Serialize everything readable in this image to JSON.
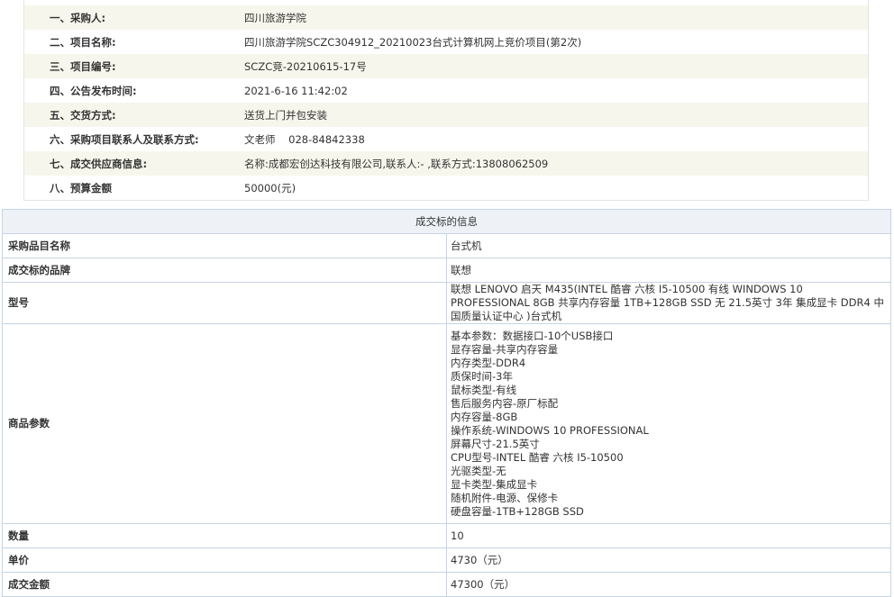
{
  "info": {
    "rows": [
      {
        "label": "一、采购人:",
        "value": "四川旅游学院"
      },
      {
        "label": "二、项目名称:",
        "value": "四川旅游学院SCZC304912_20210023台式计算机网上竞价项目(第2次)"
      },
      {
        "label": "三、项目编号:",
        "value": "SCZC竞-20210615-17号"
      },
      {
        "label": "四、公告发布时间:",
        "value": "2021-6-16 11:42:02"
      },
      {
        "label": "五、交货方式:",
        "value": "送货上门并包安装"
      },
      {
        "label": "六、采购项目联系人及联系方式:",
        "value": "文老师    028-84842338"
      },
      {
        "label": "七、成交供应商信息:",
        "value": "名称:成都宏创达科技有限公司,联系人:- ,联系方式:13808062509"
      },
      {
        "label": "八、预算金额",
        "value": "50000(元)"
      }
    ]
  },
  "deal": {
    "caption": "成交标的信息",
    "item_name_label": "采购品目名称",
    "item_name_value": "台式机",
    "brand_label": "成交标的品牌",
    "brand_value": "联想",
    "model_label": "型号",
    "model_value": "联想 LENOVO 启天 M435(INTEL 酷睿 六核 I5-10500 有线 WINDOWS 10 PROFESSIONAL 8GB 共享内存容量 1TB+128GB SSD 无 21.5英寸 3年 集成显卡 DDR4 中国质量认证中心 )台式机",
    "params_label": "商品参数",
    "params": [
      "基本参数：数据接口-10个USB接口",
      "显存容量-共享内存容量",
      "内存类型-DDR4",
      "质保时间-3年",
      "鼠标类型-有线",
      "售后服务内容-原厂标配",
      "内存容量-8GB",
      "操作系统-WINDOWS 10 PROFESSIONAL",
      "屏幕尺寸-21.5英寸",
      "CPU型号-INTEL 酷睿 六核 I5-10500",
      "光驱类型-无",
      "显卡类型-集成显卡",
      "随机附件-电源、保修卡",
      "硬盘容量-1TB+128GB SSD"
    ],
    "quantity_label": "数量",
    "quantity_value": "10",
    "unit_price_label": "单价",
    "unit_price_value": "4730（元）",
    "total_label": "成交金额",
    "total_value": "47300（元）"
  }
}
